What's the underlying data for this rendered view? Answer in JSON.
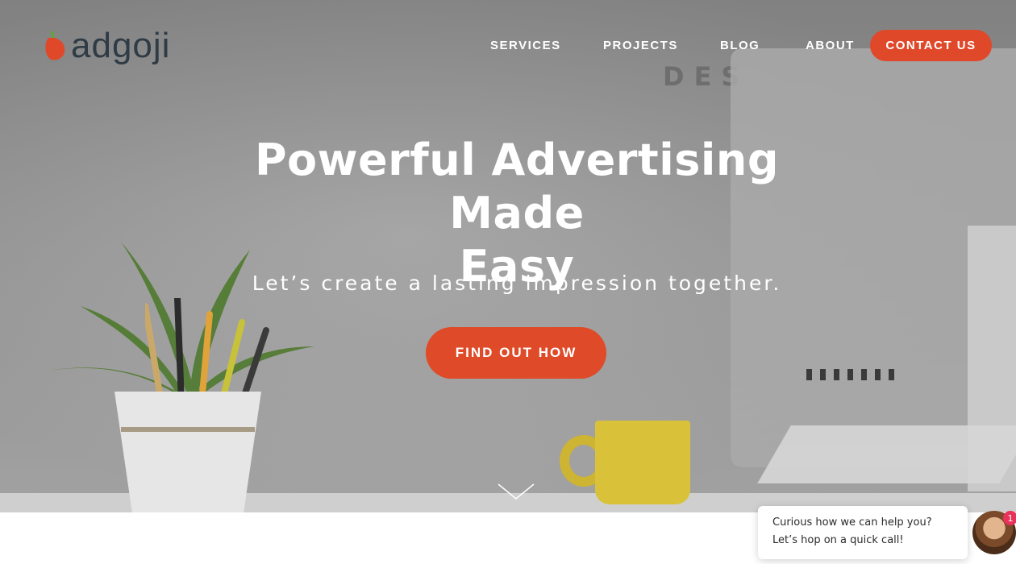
{
  "brand": {
    "logo_text": "adgoji",
    "accent_color": "#e0482a"
  },
  "nav": {
    "items": [
      {
        "label": "SERVICES"
      },
      {
        "label": "PROJECTS"
      },
      {
        "label": "BLOG"
      },
      {
        "label": "ABOUT"
      }
    ],
    "contact_label": "CONTACT US"
  },
  "hero": {
    "headline_line1": "Powerful Advertising Made",
    "headline_line2": "Easy",
    "subheadline": "Let’s create a lasting impression together.",
    "cta_label": "FIND OUT HOW",
    "scroll_icon": "chevron-down-icon",
    "background_wall_text": "DES"
  },
  "chat": {
    "message": "Curious how we can help you? Let’s hop on a quick call!",
    "unread_count": "1",
    "badge_color": "#e8325a"
  }
}
